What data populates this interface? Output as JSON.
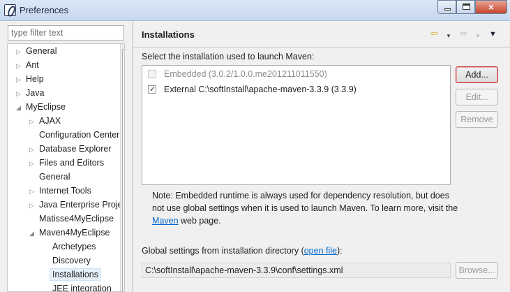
{
  "window": {
    "title": "Preferences",
    "app_icon": "myeclipse-logo-icon",
    "controls": {
      "minimize": "minimize-icon",
      "maximize": "maximize-icon",
      "close": "×"
    }
  },
  "filter": {
    "placeholder": "type filter text"
  },
  "tree": [
    {
      "label": "General",
      "level": 0,
      "expandable": true,
      "expanded": false
    },
    {
      "label": "Ant",
      "level": 0,
      "expandable": true,
      "expanded": false
    },
    {
      "label": "Help",
      "level": 0,
      "expandable": true,
      "expanded": false
    },
    {
      "label": "Java",
      "level": 0,
      "expandable": true,
      "expanded": false
    },
    {
      "label": "MyEclipse",
      "level": 0,
      "expandable": true,
      "expanded": true
    },
    {
      "label": "AJAX",
      "level": 1,
      "expandable": true,
      "expanded": false
    },
    {
      "label": "Configuration Center",
      "level": 1,
      "expandable": false
    },
    {
      "label": "Database Explorer",
      "level": 1,
      "expandable": true,
      "expanded": false
    },
    {
      "label": "Files and Editors",
      "level": 1,
      "expandable": true,
      "expanded": false
    },
    {
      "label": "General",
      "level": 1,
      "expandable": false
    },
    {
      "label": "Internet Tools",
      "level": 1,
      "expandable": true,
      "expanded": false
    },
    {
      "label": "Java Enterprise Project",
      "level": 1,
      "expandable": true,
      "expanded": false
    },
    {
      "label": "Matisse4MyEclipse",
      "level": 1,
      "expandable": false
    },
    {
      "label": "Maven4MyEclipse",
      "level": 1,
      "expandable": true,
      "expanded": true
    },
    {
      "label": "Archetypes",
      "level": 2,
      "expandable": false
    },
    {
      "label": "Discovery",
      "level": 2,
      "expandable": false
    },
    {
      "label": "Installations",
      "level": 2,
      "expandable": false,
      "selected": true
    },
    {
      "label": "JEE integration",
      "level": 2,
      "expandable": false
    }
  ],
  "page": {
    "title": "Installations",
    "nav": {
      "back": "back-arrow-icon",
      "forward": "forward-arrow-icon",
      "menu": "view-menu-icon"
    },
    "select_label": "Select the installation used to launch Maven:",
    "installations": [
      {
        "label": "Embedded (3.0.2/1.0.0.me201211011550)",
        "checked": false,
        "enabled": false
      },
      {
        "label": "External C:\\softInstall\\apache-maven-3.3.9 (3.3.9)",
        "checked": true,
        "enabled": true
      }
    ],
    "buttons": {
      "add": "Add...",
      "edit": "Edit...",
      "remove": "Remove",
      "browse": "Browse..."
    },
    "note": {
      "before": "Note: Embedded runtime is always used for dependency resolution, but does not use global settings when it is used to launch Maven. To learn more, visit the ",
      "link": "Maven",
      "after": " web page."
    },
    "global": {
      "before": "Global settings from installation directory (",
      "link": "open file",
      "after": "):",
      "path": "C:\\softInstall\\apache-maven-3.3.9\\conf\\settings.xml"
    }
  }
}
